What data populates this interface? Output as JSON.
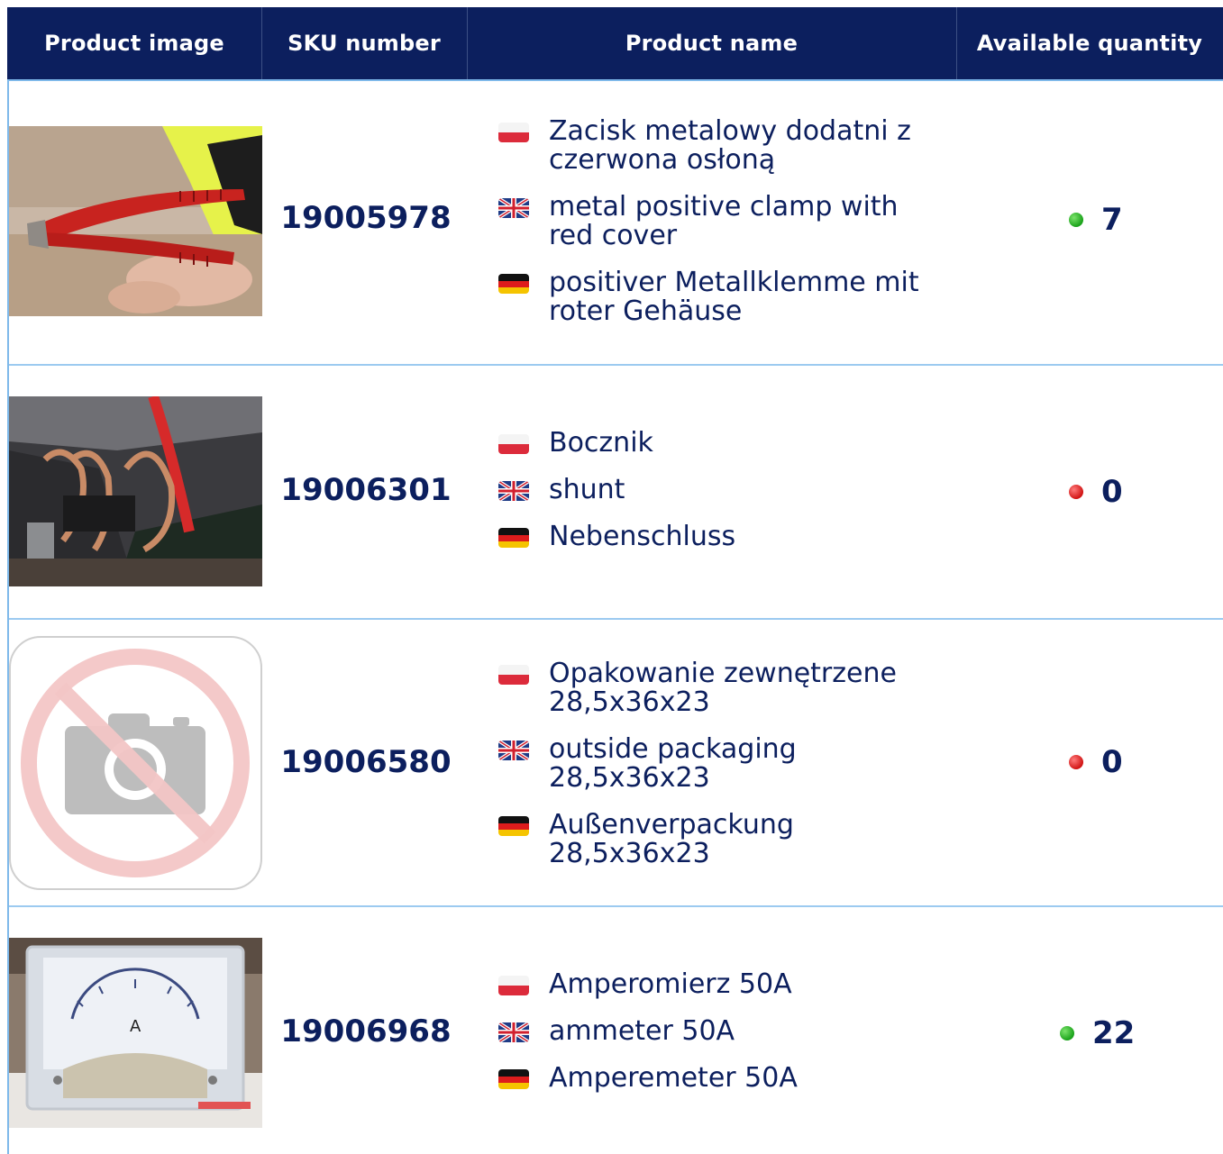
{
  "table": {
    "headers": [
      "Product image",
      "SKU number",
      "Product name",
      "Available quantity"
    ]
  },
  "rows": [
    {
      "sku": "19005978",
      "names": [
        "Zacisk metalowy dodatni z czerwona osłoną",
        "metal positive clamp with red cover",
        "positiver Metallklemme mit roter Gehäuse"
      ],
      "quantity": "7",
      "status": "in-stock",
      "image": "red-clamp-photo"
    },
    {
      "sku": "19006301",
      "names": [
        "Bocznik",
        "shunt",
        "Nebenschluss"
      ],
      "quantity": "0",
      "status": "out-of-stock",
      "image": "shunt-photo"
    },
    {
      "sku": "19006580",
      "names": [
        "Opakowanie zewnętrzene 28,5x36x23",
        "outside packaging 28,5x36x23",
        "Außenverpackung 28,5x36x23"
      ],
      "quantity": "0",
      "status": "out-of-stock",
      "image": "no-photo-placeholder"
    },
    {
      "sku": "19006968",
      "names": [
        "Amperomierz 50A",
        "ammeter 50A",
        "Amperemeter 50A"
      ],
      "quantity": "22",
      "status": "in-stock",
      "image": "ammeter-photo"
    }
  ],
  "colors": {
    "header_bg": "#0c1f5e",
    "border": "#9ccaf0",
    "in_stock": "#1aa21a",
    "out_of_stock": "#d11414"
  },
  "flags": [
    "polish-flag-icon",
    "uk-flag-icon",
    "german-flag-icon"
  ]
}
